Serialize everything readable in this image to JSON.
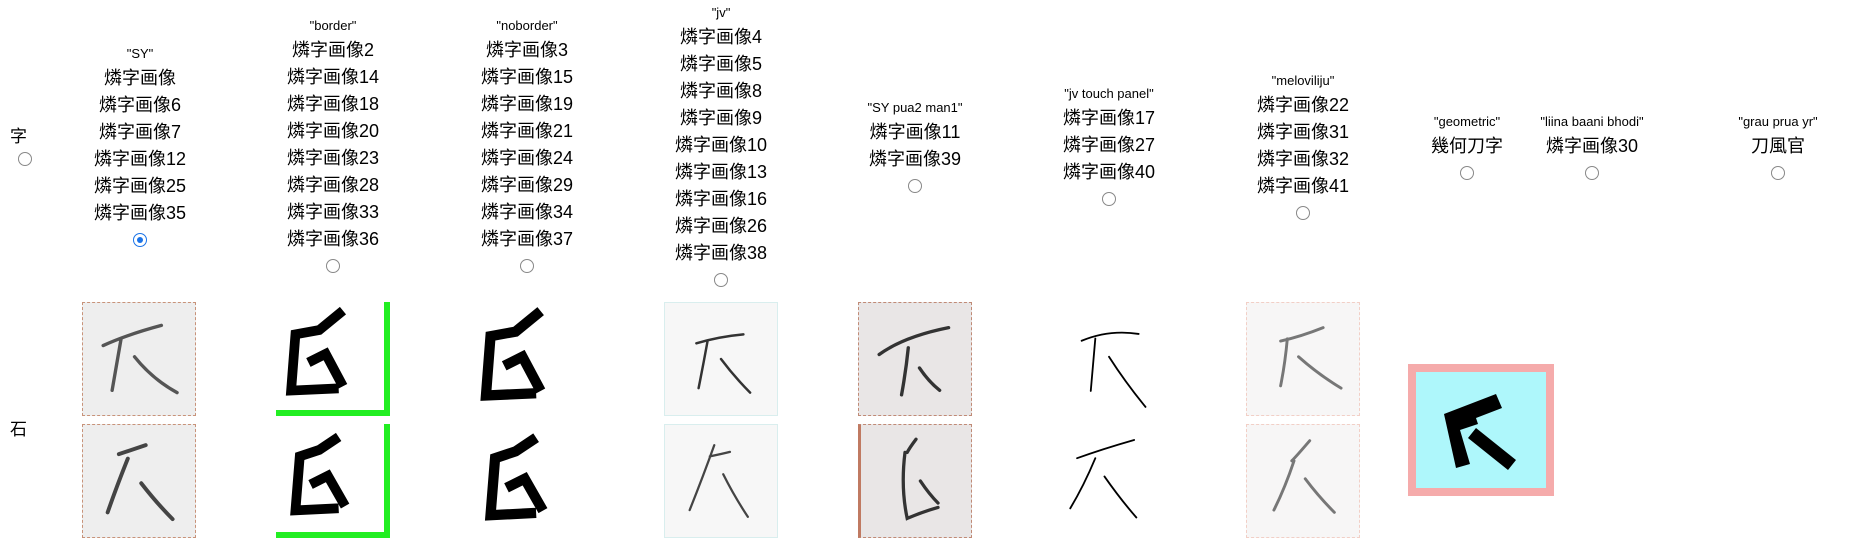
{
  "row_labels": {
    "ji": "字",
    "ishi": "石"
  },
  "columns": [
    {
      "tag": "\"SY\"",
      "items": [
        "燐字画像",
        "燐字画像6",
        "燐字画像7",
        "燐字画像12",
        "燐字画像25",
        "燐字画像35"
      ],
      "selected": true
    },
    {
      "tag": "\"border\"",
      "items": [
        "燐字画像2",
        "燐字画像14",
        "燐字画像18",
        "燐字画像20",
        "燐字画像23",
        "燐字画像28",
        "燐字画像33",
        "燐字画像36"
      ],
      "selected": false
    },
    {
      "tag": "\"noborder\"",
      "items": [
        "燐字画像3",
        "燐字画像15",
        "燐字画像19",
        "燐字画像21",
        "燐字画像24",
        "燐字画像29",
        "燐字画像34",
        "燐字画像37"
      ],
      "selected": false
    },
    {
      "tag": "\"jv\"",
      "items": [
        "燐字画像4",
        "燐字画像5",
        "燐字画像8",
        "燐字画像9",
        "燐字画像10",
        "燐字画像13",
        "燐字画像16",
        "燐字画像26",
        "燐字画像38"
      ],
      "selected": false
    },
    {
      "tag": "\"SY pua2 man1\"",
      "items": [
        "燐字画像11",
        "燐字画像39"
      ],
      "selected": false
    },
    {
      "tag": "\"jv touch panel\"",
      "items": [
        "燐字画像17",
        "燐字画像27",
        "燐字画像40"
      ],
      "selected": false
    },
    {
      "tag": "\"meloviliju\"",
      "items": [
        "燐字画像22",
        "燐字画像31",
        "燐字画像32",
        "燐字画像41"
      ],
      "selected": false
    },
    {
      "tag": "\"geometric\"",
      "items": [
        "幾何刀字"
      ],
      "selected": false
    },
    {
      "tag": "\"liina baani bhodi\"",
      "items": [
        "燐字画像30"
      ],
      "selected": false
    },
    {
      "tag": "\"grau prua yr\"",
      "items": [
        "刀風官"
      ],
      "selected": false
    }
  ],
  "colors": {
    "accent": "#1a73e8",
    "green_border": "#22ee22",
    "geo_bg": "#aef7fb",
    "geo_border": "#f5abab"
  }
}
